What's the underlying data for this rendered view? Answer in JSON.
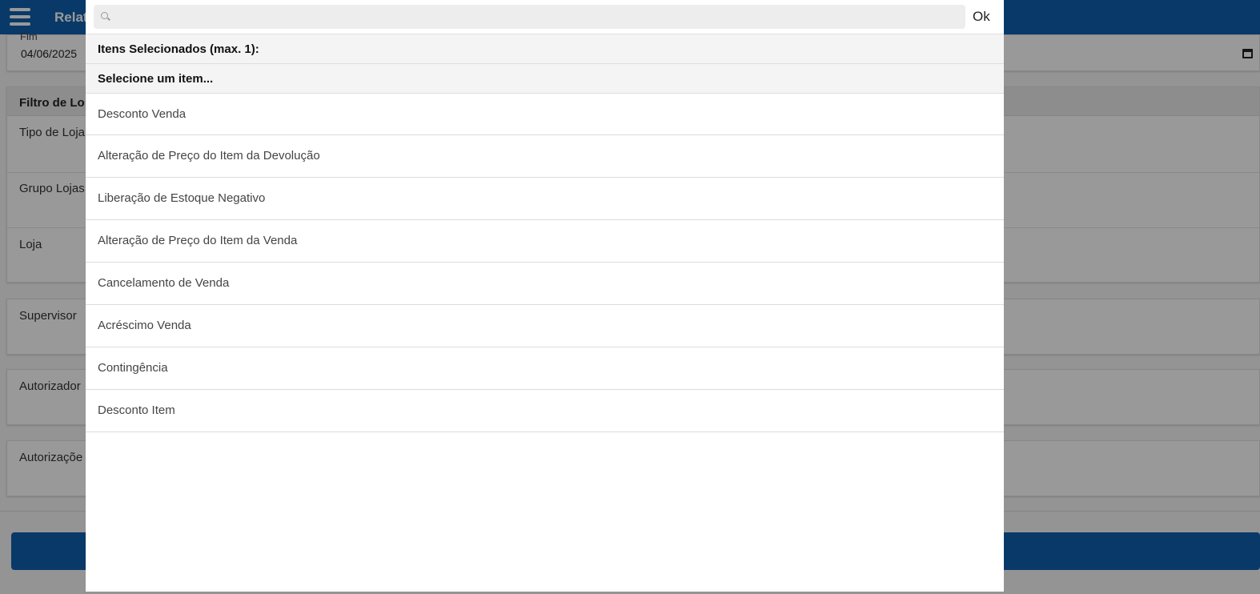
{
  "page": {
    "app_title": "Relat",
    "date_field": {
      "label": "Fim",
      "value": "04/06/2025"
    },
    "store_filter": {
      "title": "Filtro de Lo",
      "rows": [
        "Tipo de Loja",
        "Grupo Lojas",
        "Loja"
      ]
    },
    "single_cards": [
      "Supervisor",
      "Autorizador",
      "Autorizaçõe"
    ]
  },
  "modal": {
    "search": {
      "placeholder": "",
      "value": ""
    },
    "ok_label": "Ok",
    "selected_header": "Itens Selecionados (max. 1):",
    "select_header": "Selecione um item...",
    "options": [
      "Desconto Venda",
      "Alteração de Preço do Item da Devolução",
      "Liberação de Estoque Negativo",
      "Alteração de Preço do Item da Venda",
      "Cancelamento de Venda",
      "Acréscimo Venda",
      "Contingência",
      "Desconto Item"
    ]
  },
  "colors": {
    "brand_blue": "#0f5fb0",
    "overlay": "rgba(0,0,0,0.40)"
  }
}
